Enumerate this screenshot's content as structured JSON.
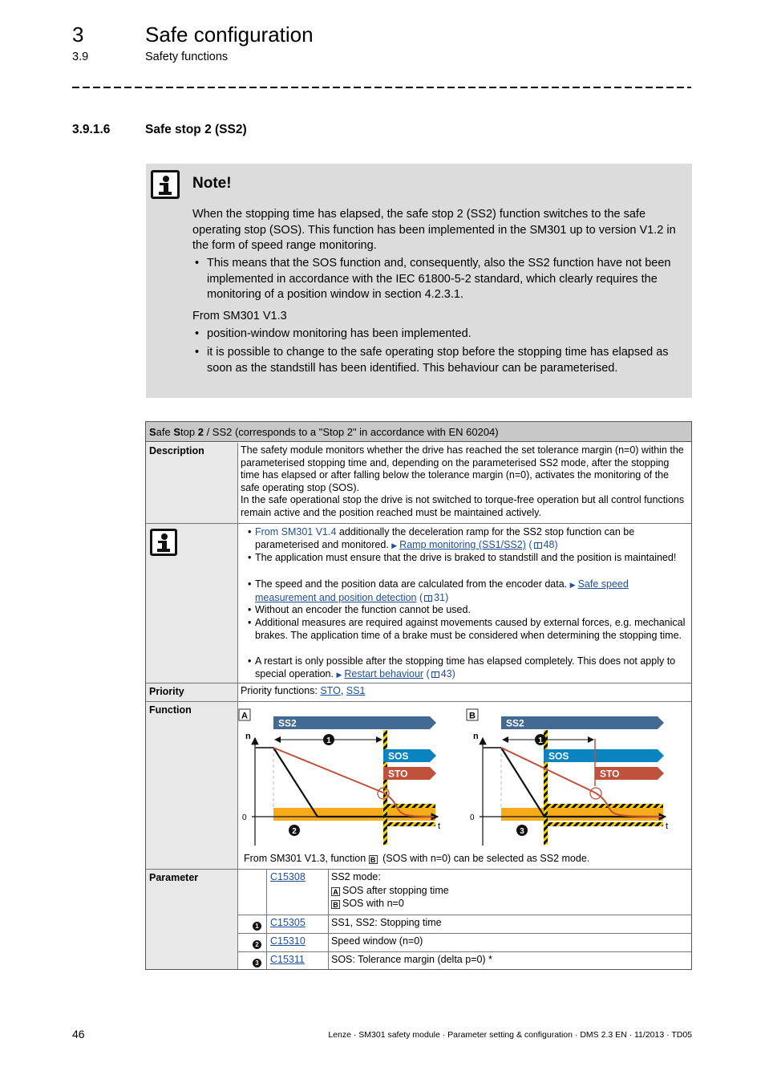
{
  "header": {
    "chapter_number": "3",
    "chapter_title": "Safe configuration",
    "section_number": "3.9",
    "section_title": "Safety functions"
  },
  "subsection": {
    "number": "3.9.1.6",
    "title": "Safe stop 2 (SS2)"
  },
  "note": {
    "icon": "info-icon",
    "title": "Note!",
    "paragraph": "When the stopping time has elapsed, the safe stop 2 (SS2) function switches to the safe operating stop (SOS). This function has been implemented in the SM301 up to version V1.2 in the form of speed range monitoring.",
    "bullet1": "This means that the SOS function and, consequently, also the SS2 function have not been implemented in accordance with the IEC 61800-5-2 standard, which clearly requires the monitoring of a position window in section 4.2.3.1.",
    "from_label": "From SM301 V1.3",
    "bullet2": "position-window monitoring has been implemented.",
    "bullet3": "it is possible to change to the safe operating stop before the stopping time has elapsed as soon as the standstill has been identified. This behaviour can be parameterised."
  },
  "table": {
    "title_s1": "S",
    "title_s2": "afe ",
    "title_s3": "S",
    "title_s4": "top ",
    "title_s5": "2",
    "title_s6": " / SS2 (corresponds to a \"Stop 2\" in accordance with EN 60204)",
    "description_label": "Description",
    "description_p1": "The safety module monitors whether the drive has reached the set tolerance margin (n=0) within the parameterised stopping time and, depending on the parameterised SS2 mode, after the stopping time has elapsed or after falling below the tolerance margin (n=0), activates the monitoring of the safe operating stop (SOS).",
    "description_p2": "In the safe operational stop the drive is not switched to torque-free operation but all control functions remain active and the position reached must be maintained actively.",
    "info_items": {
      "i1_link": "From SM301 V1.4",
      "i1_text": " additionally the deceleration ramp for the SS2 stop function can be parameterised and monitored.",
      "i1_ref": "Ramp monitoring (SS1/SS2)",
      "i1_page": "48",
      "i2_text": "The application must ensure that the drive is braked to standstill and the position is maintained!",
      "i3_text": "The speed and the position data are calculated from the encoder data.",
      "i3_ref": "Safe speed measurement and position detection",
      "i3_page": "31",
      "i4_text": "Without an encoder the function cannot be used.",
      "i5_text": "Additional measures are required against movements caused by external forces, e.g. mechanical brakes. The application time of a brake must be considered when determining the stopping time.",
      "i6_text": "A restart is only possible after the stopping time has elapsed completely. This does not apply to special operation.",
      "i6_ref": "Restart behaviour",
      "i6_page": "43"
    },
    "priority_label": "Priority",
    "priority_prefix": "Priority functions: ",
    "priority_sto": "STO",
    "priority_sep": ", ",
    "priority_ss1": "SS1",
    "function_label": "Function",
    "diagram": {
      "panel_a": "A",
      "panel_b": "B",
      "ss2": "SS2",
      "sos": "SOS",
      "sto": "STO",
      "axis_n": "n",
      "axis_t": "t",
      "zero": "0",
      "marker1": "1",
      "marker2": "2",
      "marker3": "3"
    },
    "function_note_pre": "From SM301 V1.3, function ",
    "function_note_box": "B",
    "function_note_post": " (SOS with n=0) can be selected as SS2 mode.",
    "parameter_label": "Parameter",
    "parameters": [
      {
        "marker": "",
        "code": "C15308",
        "text": "SS2 mode:",
        "optA_box": "A",
        "optA": "SOS after stopping time",
        "optB_box": "B",
        "optB": "SOS with n=0"
      },
      {
        "marker": "1",
        "code": "C15305",
        "text": "SS1, SS2: Stopping time"
      },
      {
        "marker": "2",
        "code": "C15310",
        "text": "Speed window (n=0)"
      },
      {
        "marker": "3",
        "code": "C15311",
        "text": "SOS: Tolerance margin (delta p=0) *"
      }
    ]
  },
  "footer": {
    "page_number": "46",
    "doc_info": "Lenze · SM301 safety module · Parameter setting & configuration · DMS 2.3 EN · 11/2013 · TD05"
  },
  "colors": {
    "ss2_bar": "#436a93",
    "sos_bar": "#0a84c1",
    "sto_bar": "#c0513b",
    "tolerance_band": "#f7ab1a",
    "link": "#1f4e9a",
    "note_bg": "#dcdcdc",
    "table_header_bg": "#c8c8c8"
  }
}
